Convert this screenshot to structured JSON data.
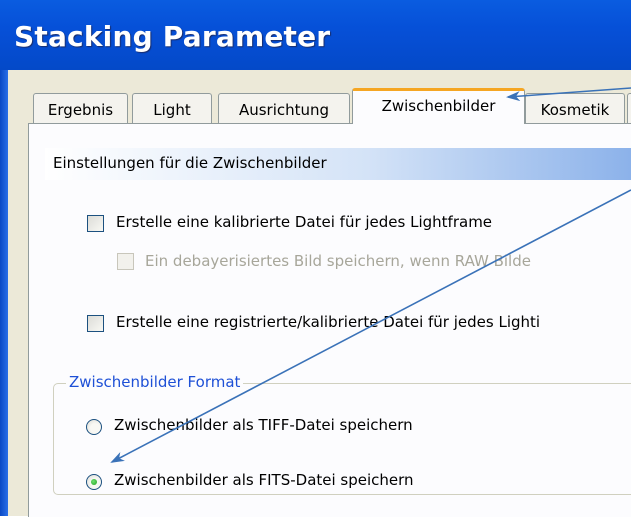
{
  "window": {
    "title": "Stacking Parameter"
  },
  "tabs": [
    {
      "label": "Ergebnis",
      "active": false
    },
    {
      "label": "Light",
      "active": false
    },
    {
      "label": "Ausrichtung",
      "active": false
    },
    {
      "label": "Zwischenbilder",
      "active": true
    },
    {
      "label": "Kosmetik",
      "active": false
    }
  ],
  "panel": {
    "section_header": "Einstellungen für die Zwischenbilder",
    "options": [
      {
        "label": "Erstelle eine kalibrierte Datei für jedes Lightframe",
        "checked": false,
        "enabled": true
      },
      {
        "label": "Ein debayerisiertes Bild speichern, wenn RAW Bilde",
        "checked": false,
        "enabled": false
      },
      {
        "label": "Erstelle eine registrierte/kalibrierte Datei für jedes Lighti",
        "checked": false,
        "enabled": true
      }
    ],
    "format_group": {
      "legend": "Zwischenbilder Format",
      "choices": [
        {
          "label": "Zwischenbilder als TIFF-Datei speichern",
          "selected": false
        },
        {
          "label": "Zwischenbilder als FITS-Datei speichern",
          "selected": true
        }
      ]
    }
  },
  "colors": {
    "title_bar": "#0650d8",
    "annotation_arrow": "#3a72b8",
    "active_tab_accent": "#f5a623",
    "group_legend": "#1e50d6"
  }
}
